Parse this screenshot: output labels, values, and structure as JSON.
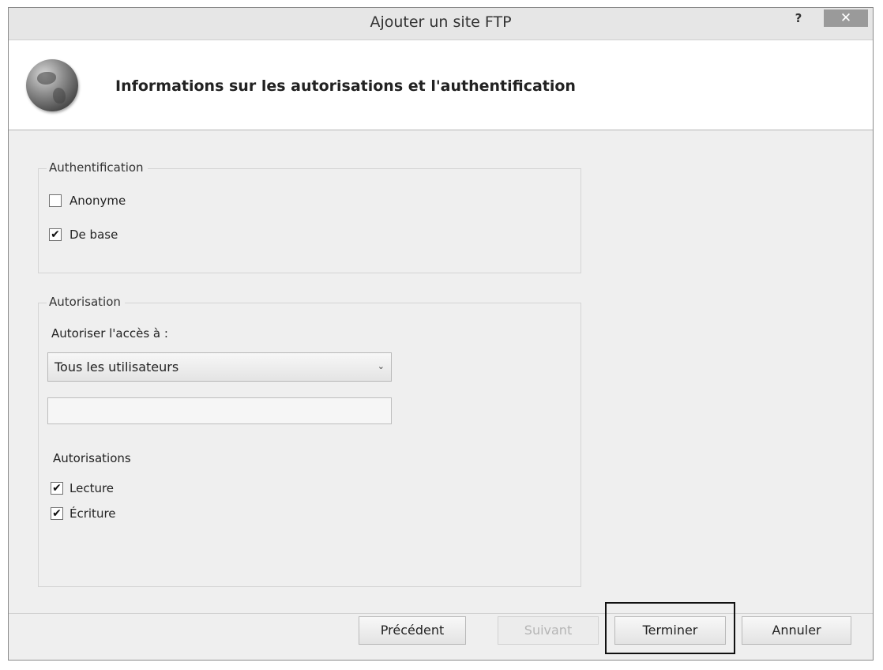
{
  "window": {
    "title": "Ajouter un site FTP",
    "help": "?",
    "close": "✕"
  },
  "header": {
    "icon": "globe-icon",
    "title": "Informations sur les autorisations et l'authentification"
  },
  "authentication": {
    "legend": "Authentification",
    "anonymous": {
      "label": "Anonyme",
      "checked": false
    },
    "basic": {
      "label": "De base",
      "checked": true
    }
  },
  "authorization": {
    "legend": "Autorisation",
    "allow_access_label": "Autoriser l'accès à :",
    "allow_access_value": "Tous les utilisateurs",
    "user_field_value": "",
    "permissions_label": "Autorisations",
    "read": {
      "label": "Lecture",
      "checked": true
    },
    "write": {
      "label": "Écriture",
      "checked": true
    }
  },
  "buttons": {
    "previous": "Précédent",
    "next": "Suivant",
    "finish": "Terminer",
    "cancel": "Annuler"
  },
  "glyphs": {
    "check": "✔",
    "chevron": "⌄"
  }
}
